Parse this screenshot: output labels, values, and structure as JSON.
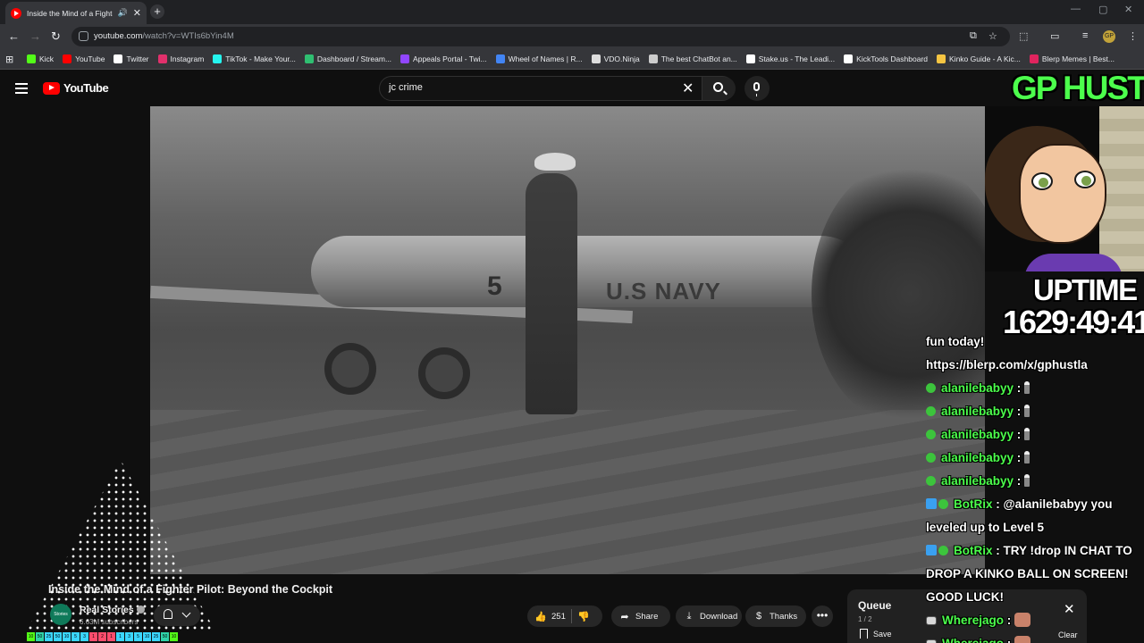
{
  "browser": {
    "tab_title": "Inside the Mind of a Fighter",
    "tab_close": "✕",
    "new_tab": "+",
    "url_host": "youtube.com",
    "url_path": "/watch?v=WTIs6bYin4M",
    "profile_initials": "GP",
    "bookmarks": [
      {
        "label": "Kick",
        "color": "#53fc18"
      },
      {
        "label": "YouTube",
        "color": "#ff0000"
      },
      {
        "label": "Twitter",
        "color": "#ffffff"
      },
      {
        "label": "Instagram",
        "color": "#e1306c"
      },
      {
        "label": "TikTok - Make Your...",
        "color": "#25f4ee"
      },
      {
        "label": "Dashboard / Stream...",
        "color": "#2fbf71"
      },
      {
        "label": "Appeals Portal - Twi...",
        "color": "#9146ff"
      },
      {
        "label": "Wheel of Names | R...",
        "color": "#4285f4"
      },
      {
        "label": "VDO.Ninja",
        "color": "#dddddd"
      },
      {
        "label": "The best ChatBot an...",
        "color": "#cccccc"
      },
      {
        "label": "Stake.us - The Leadi...",
        "color": "#ffffff"
      },
      {
        "label": "KickTools Dashboard",
        "color": "#ffffff"
      },
      {
        "label": "Kinko Guide - A Kic...",
        "color": "#f5c542"
      },
      {
        "label": "Blerp Memes | Best...",
        "color": "#e0245e"
      }
    ]
  },
  "youtube": {
    "logo_text": "YouTube",
    "search_value": "jc crime",
    "video_title": "Inside the Mind of a Fighter Pilot: Beyond the Cockpit",
    "channel_name": "Real Stories",
    "channel_avatar_text": "Stories",
    "subscribers": "6.63M subscribers",
    "like_count": "251",
    "share_label": "Share",
    "download_label": "Download",
    "thanks_label": "Thanks",
    "more_label": "•••",
    "queue": {
      "title": "Queue",
      "count": "1 / 2",
      "close": "✕",
      "save_label": "Save",
      "clear_label": "Clear"
    },
    "video_frame": {
      "plane_number": "5",
      "plane_text": "U.S NAVY"
    }
  },
  "overlay": {
    "title": "GP HUSTLA",
    "uptime_label": "UPTIME",
    "uptime_value": "1629:49:41",
    "level_bar": [
      {
        "t": "10",
        "c": "#53fc18"
      },
      {
        "t": "50",
        "c": "#2fd3a8"
      },
      {
        "t": "25",
        "c": "#3ad6ff"
      },
      {
        "t": "50",
        "c": "#3ad6ff"
      },
      {
        "t": "10",
        "c": "#3ad6ff"
      },
      {
        "t": "5",
        "c": "#3ad6ff"
      },
      {
        "t": "3",
        "c": "#3ad6ff"
      },
      {
        "t": "1",
        "c": "#ff4d6d"
      },
      {
        "t": "2",
        "c": "#ff4d6d"
      },
      {
        "t": "1",
        "c": "#ff4d6d"
      },
      {
        "t": "1",
        "c": "#3ad6ff"
      },
      {
        "t": "3",
        "c": "#3ad6ff"
      },
      {
        "t": "5",
        "c": "#3ad6ff"
      },
      {
        "t": "10",
        "c": "#3ad6ff"
      },
      {
        "t": "25",
        "c": "#3ad6ff"
      },
      {
        "t": "50",
        "c": "#2fd3a8"
      },
      {
        "t": "10",
        "c": "#53fc18"
      }
    ],
    "chat": [
      {
        "text": "fun today!"
      },
      {
        "text": "https://blerp.com/x/gphustla"
      },
      {
        "user": "alanilebabyy",
        "sep": " :"
      },
      {
        "user": "alanilebabyy",
        "sep": " :"
      },
      {
        "user": "alanilebabyy",
        "sep": " :"
      },
      {
        "user": "alanilebabyy",
        "sep": " :"
      },
      {
        "user": "alanilebabyy",
        "sep": " :"
      },
      {
        "user": "BotRix",
        "msg": " : @alanilebabyy you"
      },
      {
        "text": "leveled up to Level 5"
      },
      {
        "user": "BotRix",
        "msg": " : TRY !drop IN CHAT TO"
      },
      {
        "text": "DROP A KINKO BALL ON SCREEN!"
      },
      {
        "text": "GOOD LUCK!"
      },
      {
        "user": "Wherejago",
        "sep": " :"
      },
      {
        "user": "Wherejago",
        "sep": " :"
      }
    ]
  }
}
